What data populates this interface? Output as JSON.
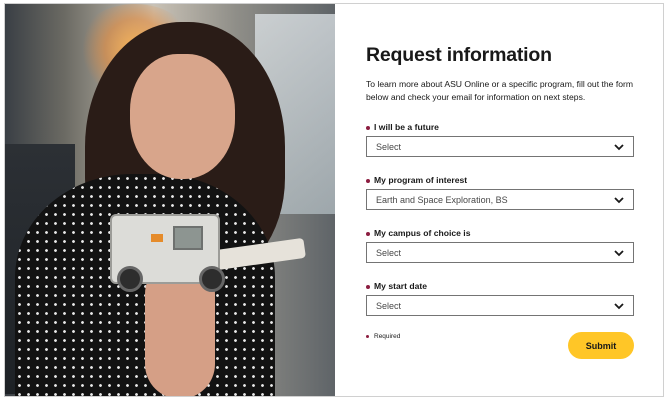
{
  "form": {
    "title": "Request information",
    "intro": "To learn more about ASU Online or a specific program, fill out the form below and check your email for information on next steps.",
    "fields": [
      {
        "label": "I will be a future",
        "value": "Select"
      },
      {
        "label": "My program of interest",
        "value": "Earth and Space Exploration, BS"
      },
      {
        "label": "My campus of choice is",
        "value": "Select"
      },
      {
        "label": "My start date",
        "value": "Select"
      }
    ],
    "required_note": "Required",
    "submit_label": "Submit"
  },
  "colors": {
    "accent_gold": "#ffc627",
    "required_maroon": "#8c1d40"
  },
  "icons": {
    "select_chevron": "chevron-down-icon"
  }
}
